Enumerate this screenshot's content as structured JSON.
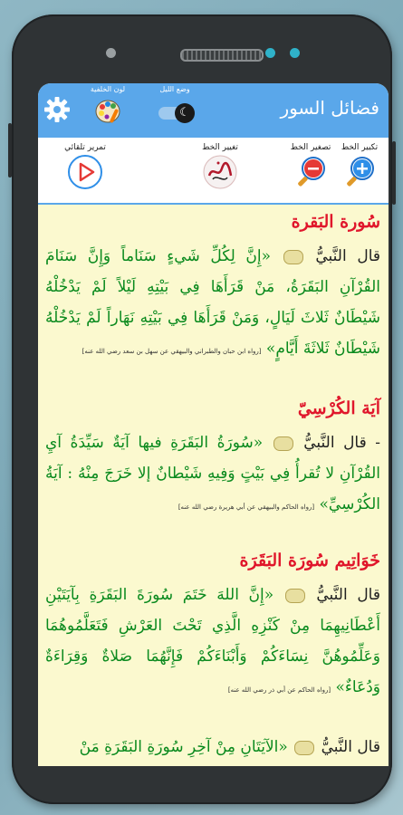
{
  "app": {
    "title": "فضائل السور",
    "background_color": "#5aa7ea",
    "page_color": "#fbf9cf",
    "accent_red": "#e0162b",
    "hadith_green": "#0a8a1e"
  },
  "header": {
    "settings_icon": "gear-icon",
    "bg_color_label": "لون الخلفية",
    "night_mode_label": "وضع الليل",
    "night_mode_on": true
  },
  "toolbar": {
    "zoom_in_label": "تكبير الخط",
    "zoom_out_label": "تصغير الخط",
    "change_font_label": "تغيير الخط",
    "auto_scroll_label": "تمرير تلقائي"
  },
  "sections": [
    {
      "title": "سُورة البَقرة",
      "lead": "قال النَّبيُّ",
      "text": "«إِنَّ لِكُلِّ شَيءٍ سَنَاماً وَإِنَّ سَنَامَ القُرْآنِ البَقَرَةُ، مَنْ قَرَأَهَا فِي بَيْتِهِ لَيْلاً لَمْ يَدْخُلْهُ شَيْطَانٌ ثَلاثَ لَيَالٍ، وَمَنْ قَرَأَهَا فِي بَيْتِهِ نَهَاراً لَمْ يَدْخُلْهُ شَيْطَانٌ ثَلاثَةَ أَيَّامٍ»",
      "source": "[رواه ابن حبان والطبراني والبيهقي عن سهل بن سعد رضي الله عنه]"
    },
    {
      "title": "آيَة الكُرْسِيّ",
      "lead": "- قال النَّبيُّ",
      "text": "«سُورَةُ البَقَرَةِ فيها آيَةٌ سَيِّدَةُ آيِ القُرْآنِ لا تُقرأُ فِي بَيْتٍ وَفِيهِ شَيْطانٌ إلا خَرَجَ مِنْهُ : آيَةُ الكُرْسِيِّ»",
      "source": "[رواه الحاكم والبيهقي عن أبي هريرة رضي الله عنه]"
    },
    {
      "title": "خَوَاتِيم سُورَة البَقَرَة",
      "lead": "قال النَّبيُّ",
      "text": "«إِنَّ اللهَ خَتَمَ سُورَةَ البَقَرَةِ بِآيَتَيْنِ أَعْطَانِيهِمَا مِنْ كَنْزِهِ الَّذِي تَحْتَ العَرْشِ فَتَعَلَّمُوهُمَا وَعَلِّمُوهُنَّ نِسَاءَكُمْ وَأَبْنَاءَكُمْ فَإِنَّهُمَا صَلاةٌ وَقِرَاءَةٌ وَدُعَاءٌ»",
      "source": "[رواه الحاكم عن أبي ذر رضي الله عنه]"
    },
    {
      "lead": "قال النَّبيُّ",
      "text": "«الآيَتَانِ مِنْ آخِرِ سُورَةِ البَقَرَةِ مَنْ"
    }
  ]
}
